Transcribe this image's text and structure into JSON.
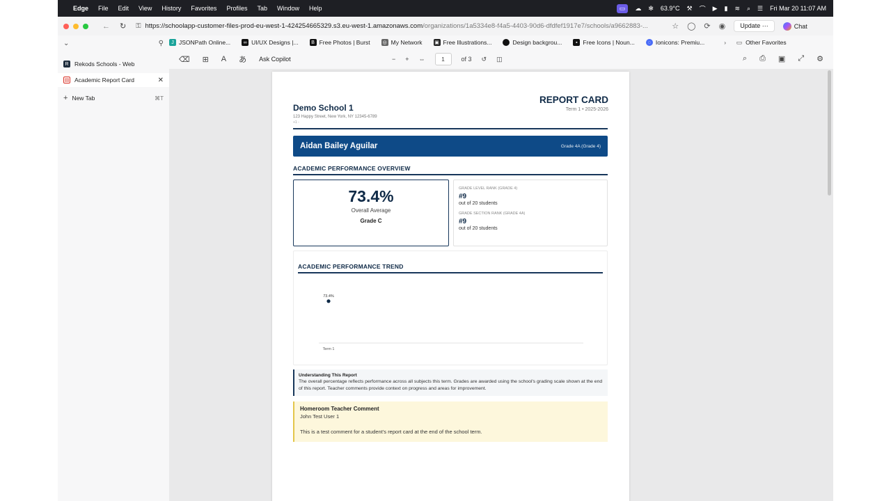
{
  "menubar": {
    "app": "Edge",
    "items": [
      "File",
      "Edit",
      "View",
      "History",
      "Favorites",
      "Profiles",
      "Tab",
      "Window",
      "Help"
    ],
    "temperature": "63.9°C",
    "datetime": "Fri Mar 20  11:07 AM"
  },
  "browser": {
    "url_main": "https://schoolapp-customer-files-prod-eu-west-1-424254665329.s3.eu-west-1.amazonaws.com",
    "url_rest": "/organizations/1a5334e8-f4a5-4403-90d6-dfdfef1917e7/schools/a9662883-...",
    "update_label": "Update",
    "chat_label": "Chat",
    "favorites": [
      {
        "label": "JSONPath Online...",
        "color": "#1aa39a",
        "icon": "J"
      },
      {
        "label": "UI/UX Designs |...",
        "color": "#111111",
        "icon": "∞"
      },
      {
        "label": "Free Photos | Burst",
        "color": "#111111",
        "icon": "B"
      },
      {
        "label": "My Network",
        "color": "#666666",
        "icon": "◎"
      },
      {
        "label": "Free Illustrations...",
        "color": "#222222",
        "icon": "▣"
      },
      {
        "label": "Design backgrou...",
        "color": "#111111",
        "icon": "●"
      },
      {
        "label": "Free Icons | Noun...",
        "color": "#111111",
        "icon": "▪"
      },
      {
        "label": "Ionicons: Premiu...",
        "color": "#4a6cf7",
        "icon": "◌"
      }
    ],
    "other_favorites": "Other Favorites"
  },
  "tabs": [
    {
      "label": "Rekods Schools - Web",
      "icon": "R",
      "color": "#1f2d3d",
      "active": false
    },
    {
      "label": "Academic Report Card",
      "icon": "▤",
      "color": "#d93025",
      "active": true
    }
  ],
  "new_tab": {
    "label": "New Tab",
    "shortcut": "⌘T"
  },
  "pdf_toolbar": {
    "ask_copilot": "Ask Copilot",
    "page_current": "1",
    "page_total": "of 3"
  },
  "report": {
    "school_name": "Demo School 1",
    "school_address": "123 Happy Street, New York, NY 12345-6789",
    "school_phone": "+1 -",
    "title": "REPORT CARD",
    "term": "Term 1 • 2025-2026",
    "student_name": "Aidan Bailey Aguilar",
    "student_grade": "Grade 4A (Grade 4)",
    "overview_title": "ACADEMIC PERFORMANCE OVERVIEW",
    "average_value": "73.4%",
    "average_label": "Overall Average",
    "average_grade": "Grade C",
    "rank1_label": "GRADE LEVEL RANK (GRADE 4)",
    "rank1_value": "#9",
    "rank1_sub": "out of 20 students",
    "rank2_label": "GRADE SECTION RANK (GRADE 4A)",
    "rank2_value": "#9",
    "rank2_sub": "out of 20 students",
    "trend_title": "ACADEMIC PERFORMANCE TREND",
    "understand_title": "Understanding This Report",
    "understand_text": "The overall percentage reflects performance across all subjects this term. Grades are awarded using the school's grading scale shown at the end of this report. Teacher comments provide context on progress and areas for improvement.",
    "comment_title": "Homeroom Teacher Comment",
    "comment_teacher": "John Test User 1",
    "comment_text": "This is a test comment for a student's report card at the end of the school term."
  },
  "chart_data": {
    "type": "line",
    "categories": [
      "Term 1"
    ],
    "series": [
      {
        "values": [
          73.4
        ]
      }
    ],
    "data_labels": [
      "73.4%"
    ]
  }
}
